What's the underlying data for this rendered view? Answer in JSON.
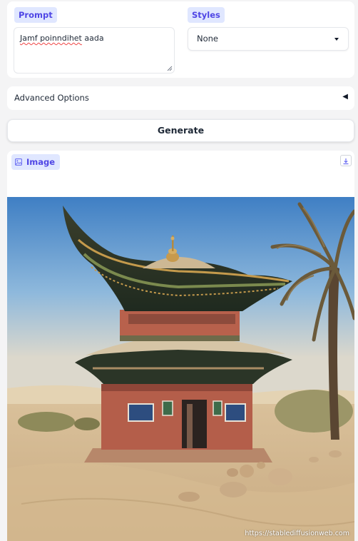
{
  "prompt": {
    "label": "Prompt",
    "value_part1": "Jamf poinndihet",
    "value_part2": " aada"
  },
  "styles": {
    "label": "Styles",
    "selected": "None"
  },
  "advanced": {
    "label": "Advanced Options",
    "toggle_glyph": "◀"
  },
  "generate": {
    "label": "Generate"
  },
  "output": {
    "label": "Image",
    "label_icon": "image-icon",
    "download_icon": "download-icon",
    "watermark": "https://stablediffusionweb.com"
  },
  "colors": {
    "accent": "#4f46e5",
    "accent_bg": "#e0e7ff",
    "panel_bg": "#ffffff",
    "page_bg": "#f4f4f5"
  }
}
